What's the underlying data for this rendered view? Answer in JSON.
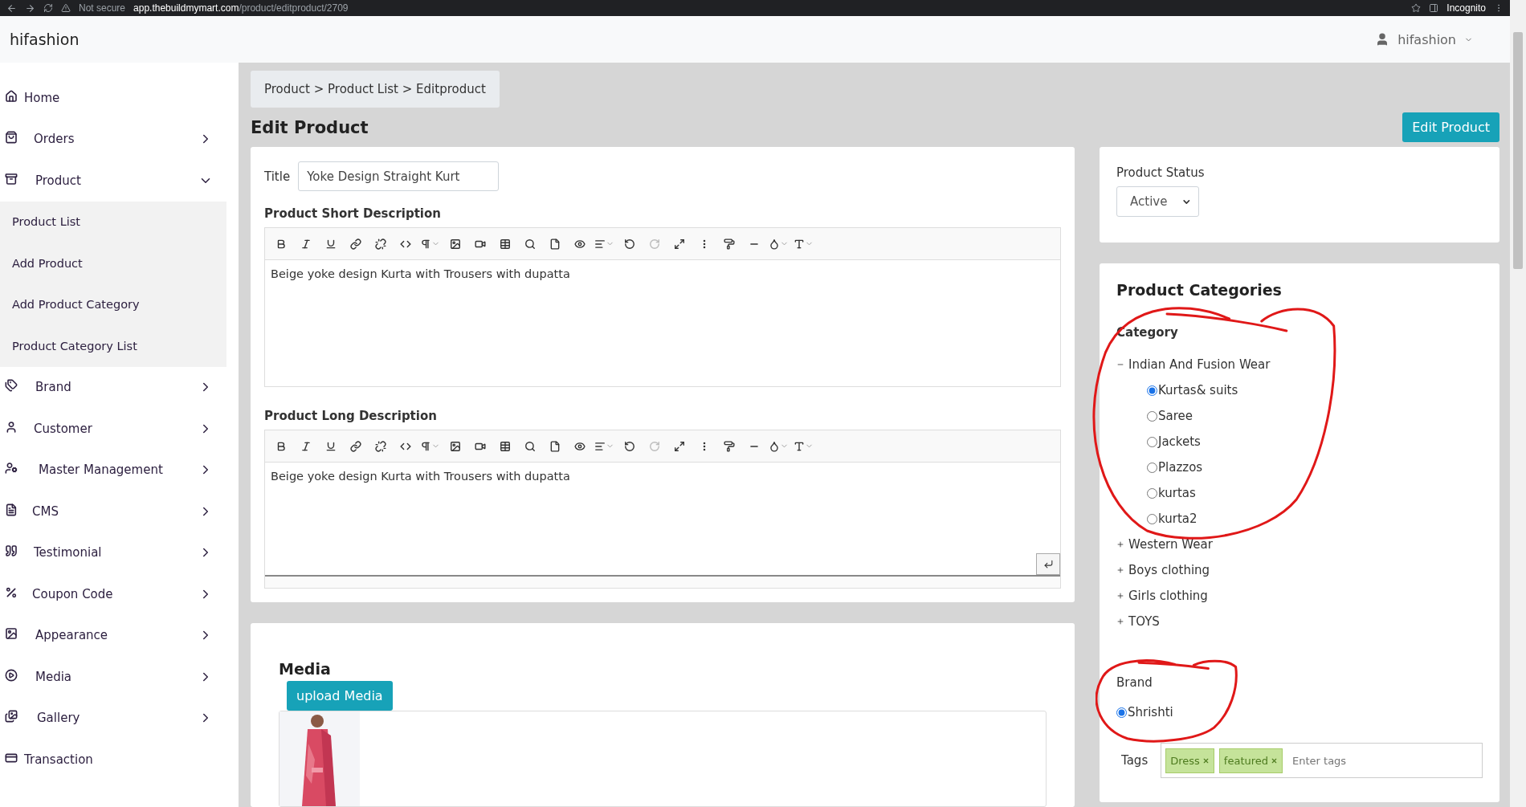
{
  "browser": {
    "security": "Not secure",
    "host": "app.thebuildmymart.com",
    "path": "/product/editproduct/2709",
    "mode": "Incognito"
  },
  "header": {
    "brand": "hifashion",
    "user": "hifashion"
  },
  "sidebar": {
    "items": [
      {
        "label": "Home",
        "kind": "link"
      },
      {
        "label": "Orders",
        "kind": "group",
        "expanded": false
      },
      {
        "label": "Product",
        "kind": "group",
        "expanded": true,
        "children": [
          {
            "label": "Product List"
          },
          {
            "label": "Add Product"
          },
          {
            "label": "Add Product Category"
          },
          {
            "label": "Product Category List"
          }
        ]
      },
      {
        "label": "Brand",
        "kind": "group",
        "expanded": false
      },
      {
        "label": "Customer",
        "kind": "group",
        "expanded": false
      },
      {
        "label": "Master Management",
        "kind": "group",
        "expanded": false
      },
      {
        "label": "CMS",
        "kind": "group",
        "expanded": false
      },
      {
        "label": "Testimonial",
        "kind": "group",
        "expanded": false
      },
      {
        "label": "Coupon Code",
        "kind": "group",
        "expanded": false
      },
      {
        "label": "Appearance",
        "kind": "group",
        "expanded": false
      },
      {
        "label": "Media",
        "kind": "group",
        "expanded": false
      },
      {
        "label": "Gallery",
        "kind": "group",
        "expanded": false
      },
      {
        "label": "Transaction",
        "kind": "link"
      }
    ]
  },
  "breadcrumb": "Product > Product List > Editproduct",
  "page_title": "Edit Product",
  "primary_button": "Edit Product",
  "form": {
    "title_label": "Title",
    "title_value": "Yoke Design Straight Kurt",
    "editors": [
      {
        "label": "Product Short Description",
        "content": "Beige yoke design Kurta with Trousers with dupatta",
        "redo_enabled": false,
        "has_enter_button": false
      },
      {
        "label": "Product Long Description",
        "content": "Beige yoke design Kurta with Trousers with dupatta",
        "redo_enabled": false,
        "has_enter_button": true
      }
    ]
  },
  "status": {
    "label": "Product Status",
    "value": "Active"
  },
  "categories": {
    "title": "Product Categories",
    "label": "Category",
    "groups": [
      {
        "name": "Indian And Fusion Wear",
        "expanded": true,
        "children": [
          {
            "label": "Kurtas& suits",
            "selected": true
          },
          {
            "label": "Saree",
            "selected": false
          },
          {
            "label": "Jackets",
            "selected": false
          },
          {
            "label": "Plazzos",
            "selected": false
          },
          {
            "label": "kurtas",
            "selected": false
          },
          {
            "label": "kurta2",
            "selected": false
          }
        ]
      },
      {
        "name": "Western Wear",
        "expanded": false
      },
      {
        "name": "Boys clothing",
        "expanded": false
      },
      {
        "name": "Girls clothing",
        "expanded": false
      },
      {
        "name": "TOYS",
        "expanded": false
      }
    ]
  },
  "brand": {
    "label": "Brand",
    "options": [
      {
        "label": "Shrishti",
        "selected": true
      }
    ]
  },
  "tags": {
    "label": "Tags",
    "items": [
      "Dress",
      "featured"
    ],
    "placeholder": "Enter tags"
  },
  "media": {
    "title": "Media",
    "button": "upload Media"
  },
  "annotations": [
    {
      "kind": "loop"
    },
    {
      "kind": "loop"
    }
  ]
}
